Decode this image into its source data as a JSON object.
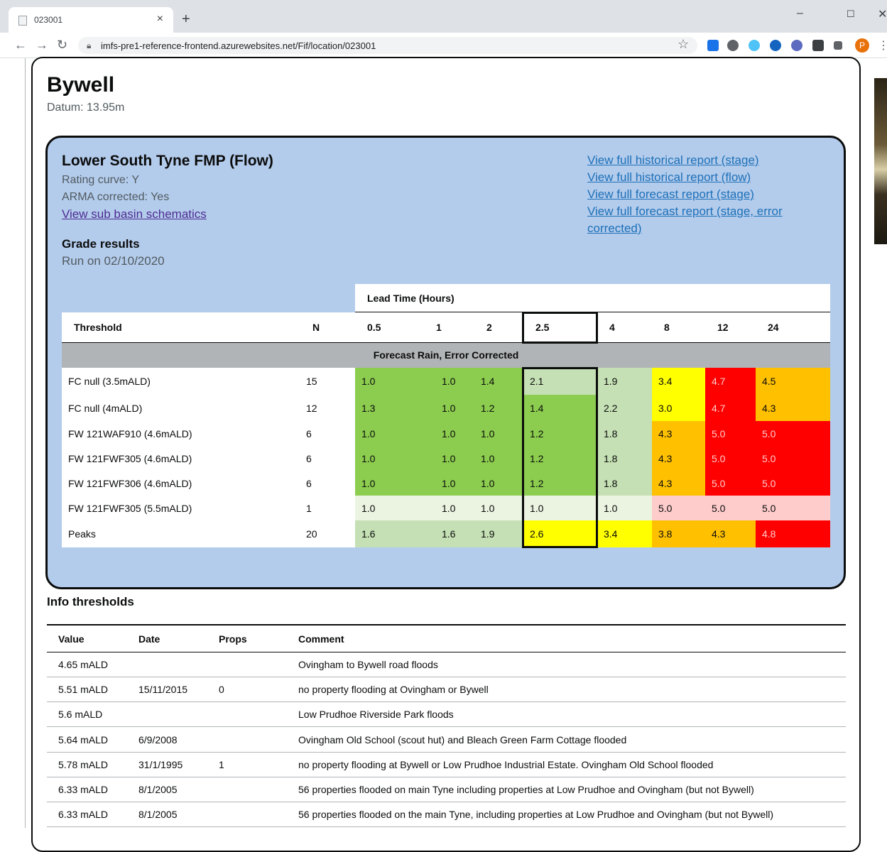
{
  "browser": {
    "tab_title": "023001",
    "url": "imfs-pre1-reference-frontend.azurewebsites.net/Fif/location/023001",
    "profile_initial": "P"
  },
  "site": {
    "title": "Bywell",
    "datum": "Datum: 13.95m"
  },
  "model": {
    "title": "Lower South Tyne FMP (Flow)",
    "rating_curve": "Rating curve: Y",
    "arma": "ARMA corrected: Yes",
    "schematics_link": "View sub basin schematics",
    "links": [
      "View full historical report (stage)",
      "View full historical report (flow)",
      "View full forecast report (stage)",
      "View full forecast report (stage, error corrected)"
    ],
    "grade_title": "Grade results",
    "run_on": "Run on 02/10/2020"
  },
  "grade_table": {
    "lead_time_label": "Lead Time (Hours)",
    "threshold_header": "Threshold",
    "n_header": "N",
    "lead_times": [
      "0.5",
      "1",
      "2",
      "2.5",
      "4",
      "8",
      "12",
      "24"
    ],
    "section_label": "Forecast Rain, Error Corrected",
    "selected_column": "2.5",
    "colors": {
      "dark_green": "#8ccd4f",
      "light_green": "#c5e0b4",
      "pale_green": "#eaf4e0",
      "yellow": "#ffff00",
      "orange": "#ffc000",
      "red": "#ff0000",
      "pink": "#ffcccc"
    },
    "rows": [
      {
        "threshold": "FC null (3.5mALD)",
        "n": "15",
        "values": [
          "1.0",
          "1.0",
          "1.4",
          "2.1",
          "1.9",
          "3.4",
          "4.7",
          "4.5"
        ],
        "colors": [
          "dark_green",
          "dark_green",
          "dark_green",
          "light_green",
          "light_green",
          "yellow",
          "red",
          "orange"
        ]
      },
      {
        "threshold": "FC null (4mALD)",
        "n": "12",
        "values": [
          "1.3",
          "1.0",
          "1.2",
          "1.4",
          "2.2",
          "3.0",
          "4.7",
          "4.3"
        ],
        "colors": [
          "dark_green",
          "dark_green",
          "dark_green",
          "dark_green",
          "light_green",
          "yellow",
          "red",
          "orange"
        ]
      },
      {
        "threshold": "FW 121WAF910 (4.6mALD)",
        "n": "6",
        "values": [
          "1.0",
          "1.0",
          "1.0",
          "1.2",
          "1.8",
          "4.3",
          "5.0",
          "5.0"
        ],
        "colors": [
          "dark_green",
          "dark_green",
          "dark_green",
          "dark_green",
          "light_green",
          "orange",
          "red",
          "red"
        ]
      },
      {
        "threshold": "FW 121FWF305 (4.6mALD)",
        "n": "6",
        "values": [
          "1.0",
          "1.0",
          "1.0",
          "1.2",
          "1.8",
          "4.3",
          "5.0",
          "5.0"
        ],
        "colors": [
          "dark_green",
          "dark_green",
          "dark_green",
          "dark_green",
          "light_green",
          "orange",
          "red",
          "red"
        ]
      },
      {
        "threshold": "FW 121FWF306 (4.6mALD)",
        "n": "6",
        "values": [
          "1.0",
          "1.0",
          "1.0",
          "1.2",
          "1.8",
          "4.3",
          "5.0",
          "5.0"
        ],
        "colors": [
          "dark_green",
          "dark_green",
          "dark_green",
          "dark_green",
          "light_green",
          "orange",
          "red",
          "red"
        ]
      },
      {
        "threshold": "FW 121FWF305 (5.5mALD)",
        "n": "1",
        "values": [
          "1.0",
          "1.0",
          "1.0",
          "1.0",
          "1.0",
          "5.0",
          "5.0",
          "5.0"
        ],
        "colors": [
          "pale_green",
          "pale_green",
          "pale_green",
          "pale_green",
          "pale_green",
          "pink",
          "pink",
          "pink"
        ]
      },
      {
        "threshold": "Peaks",
        "n": "20",
        "values": [
          "1.6",
          "1.6",
          "1.9",
          "2.6",
          "3.4",
          "3.8",
          "4.3",
          "4.8"
        ],
        "colors": [
          "light_green",
          "light_green",
          "light_green",
          "yellow",
          "yellow",
          "orange",
          "orange",
          "red"
        ]
      }
    ]
  },
  "info_thresholds": {
    "title": "Info thresholds",
    "headers": [
      "Value",
      "Date",
      "Props",
      "Comment"
    ],
    "rows": [
      [
        "4.65 mALD",
        "",
        "",
        "Ovingham to Bywell road floods"
      ],
      [
        "5.51 mALD",
        "15/11/2015",
        "0",
        "no property flooding at Ovingham or Bywell"
      ],
      [
        "5.6 mALD",
        "",
        "",
        "Low Prudhoe Riverside Park floods"
      ],
      [
        "5.64 mALD",
        "6/9/2008",
        "",
        "Ovingham Old School (scout hut) and Bleach Green Farm Cottage flooded"
      ],
      [
        "5.78 mALD",
        "31/1/1995",
        "1",
        "no property flooding at Bywell or Low Prudhoe Industrial Estate. Ovingham Old School flooded"
      ],
      [
        "6.33 mALD",
        "8/1/2005",
        "",
        "56 properties flooded on main Tyne including properties at Low Prudhoe and Ovingham (but not Bywell)"
      ],
      [
        "6.33 mALD",
        "8/1/2005",
        "",
        "56 properties flooded on the main Tyne, including properties at Low Prudhoe and Ovingham (but not Bywell)"
      ]
    ]
  }
}
